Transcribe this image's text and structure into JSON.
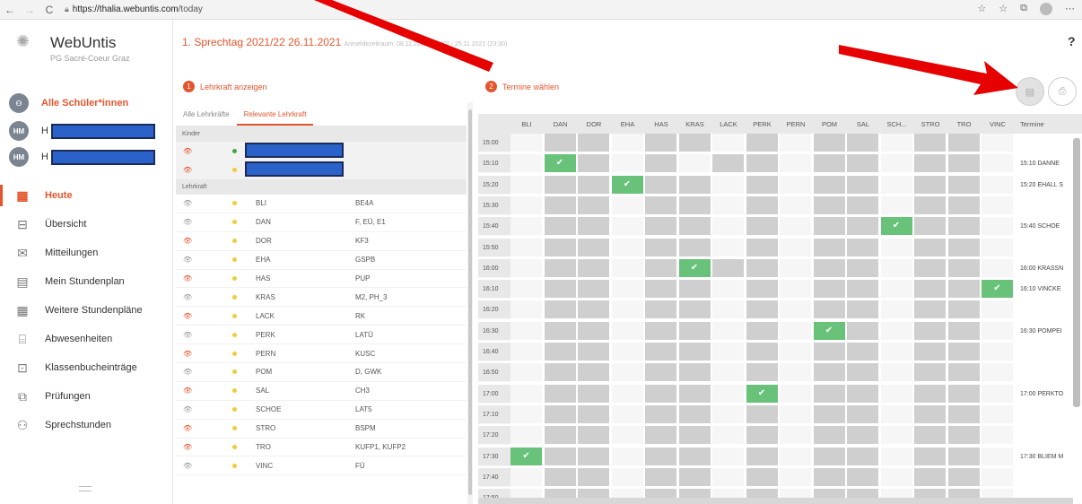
{
  "browser": {
    "back": "←",
    "forward": "→",
    "reload": "C",
    "url_host": "https://thalia.webuntis.com",
    "url_path": "/today"
  },
  "sidebar": {
    "brand": "WebUntis",
    "school": "PG Sacré-Coeur Graz",
    "all_students": "Alle Schüler*innen",
    "students": [
      {
        "initials": "HM",
        "name_prefix": "H"
      },
      {
        "initials": "HM",
        "name_prefix": "H"
      }
    ],
    "menu": [
      {
        "label": "Heute",
        "icon": "today-icon",
        "active": true
      },
      {
        "label": "Übersicht",
        "icon": "overview-icon"
      },
      {
        "label": "Mitteilungen",
        "icon": "mail-icon"
      },
      {
        "label": "Mein Stundenplan",
        "icon": "calendar-icon"
      },
      {
        "label": "Weitere Stundenpläne",
        "icon": "calendar-grid-icon"
      },
      {
        "label": "Abwesenheiten",
        "icon": "absence-icon"
      },
      {
        "label": "Klassenbucheinträge",
        "icon": "classbook-icon"
      },
      {
        "label": "Prüfungen",
        "icon": "exam-icon"
      },
      {
        "label": "Sprechstunden",
        "icon": "consultation-icon"
      }
    ]
  },
  "header": {
    "title": "1. Sprechtag 2021/22 26.11.2021",
    "registration": "Anmeldezeitraum: 08.11.2021 (00:00) - 25.11.2021 (23:30)",
    "help": "?"
  },
  "steps": {
    "step1": {
      "num": "1",
      "label": "Lehrkraft anzeigen"
    },
    "step2": {
      "num": "2",
      "label": "Termine wählen"
    }
  },
  "teacher_tabs": {
    "all": "Alle Lehrkräfte",
    "relevant": "Relevante Lehrkraft"
  },
  "groups": {
    "kinder": "Kinder",
    "lehrkraft": "Lehrkraft"
  },
  "teachers": [
    {
      "code": "BLI",
      "subjects": "BE4A",
      "eye": "grey"
    },
    {
      "code": "DAN",
      "subjects": "F, EÜ, E1",
      "eye": "grey"
    },
    {
      "code": "DOR",
      "subjects": "KF3",
      "eye": "red"
    },
    {
      "code": "EHA",
      "subjects": "GSPB",
      "eye": "grey"
    },
    {
      "code": "HAS",
      "subjects": "PUP",
      "eye": "red"
    },
    {
      "code": "KRAS",
      "subjects": "M2, PH_3",
      "eye": "grey"
    },
    {
      "code": "LACK",
      "subjects": "RK",
      "eye": "red"
    },
    {
      "code": "PERK",
      "subjects": "LATÜ",
      "eye": "grey"
    },
    {
      "code": "PERN",
      "subjects": "KUSC",
      "eye": "red"
    },
    {
      "code": "POM",
      "subjects": "D, GWK",
      "eye": "grey"
    },
    {
      "code": "SAL",
      "subjects": "CH3",
      "eye": "red"
    },
    {
      "code": "SCHOE",
      "subjects": "LAT5",
      "eye": "grey"
    },
    {
      "code": "STRO",
      "subjects": "BSPM",
      "eye": "red"
    },
    {
      "code": "TRO",
      "subjects": "KUFP1, KUFP2",
      "eye": "red"
    },
    {
      "code": "VINC",
      "subjects": "FÜ",
      "eye": "grey"
    }
  ],
  "grid": {
    "columns": [
      "BLI",
      "DAN",
      "DOR",
      "EHA",
      "HAS",
      "KRAS",
      "LACK",
      "PERK",
      "PERN",
      "POM",
      "SAL",
      "SCH...",
      "STRO",
      "TRO",
      "VINC"
    ],
    "termine_header": "Termine",
    "times": [
      "15:00",
      "15:10",
      "15:20",
      "15:30",
      "15:40",
      "15:50",
      "16:00",
      "16:10",
      "16:20",
      "16:30",
      "16:40",
      "16:50",
      "17:00",
      "17:10",
      "17:20",
      "17:30",
      "17:40",
      "17:50"
    ],
    "available": [
      [
        0,
        1,
        1,
        0,
        1,
        1,
        0,
        1,
        0,
        1,
        1,
        0,
        1,
        1,
        0
      ],
      [
        0,
        1,
        1,
        0,
        1,
        0,
        1,
        1,
        0,
        1,
        1,
        0,
        1,
        1,
        0
      ],
      [
        0,
        1,
        1,
        0,
        1,
        1,
        0,
        1,
        0,
        1,
        1,
        0,
        1,
        1,
        0
      ],
      [
        0,
        1,
        1,
        0,
        1,
        1,
        0,
        1,
        0,
        1,
        1,
        0,
        1,
        1,
        0
      ],
      [
        0,
        1,
        1,
        0,
        1,
        1,
        0,
        1,
        0,
        1,
        1,
        0,
        1,
        1,
        0
      ],
      [
        0,
        1,
        1,
        0,
        1,
        1,
        0,
        1,
        0,
        1,
        1,
        0,
        1,
        1,
        0
      ],
      [
        0,
        1,
        1,
        0,
        1,
        0,
        1,
        1,
        0,
        1,
        1,
        0,
        1,
        1,
        0
      ],
      [
        0,
        1,
        1,
        0,
        1,
        1,
        0,
        1,
        0,
        1,
        1,
        0,
        1,
        1,
        0
      ],
      [
        0,
        1,
        1,
        0,
        1,
        1,
        0,
        1,
        0,
        1,
        1,
        0,
        1,
        1,
        0
      ],
      [
        0,
        1,
        1,
        0,
        1,
        1,
        0,
        1,
        0,
        1,
        1,
        0,
        1,
        1,
        0
      ],
      [
        0,
        1,
        1,
        0,
        1,
        1,
        0,
        1,
        0,
        1,
        1,
        0,
        1,
        1,
        0
      ],
      [
        0,
        1,
        1,
        0,
        1,
        1,
        0,
        1,
        0,
        1,
        1,
        0,
        1,
        1,
        0
      ],
      [
        0,
        1,
        1,
        0,
        1,
        1,
        0,
        1,
        0,
        1,
        1,
        0,
        1,
        1,
        0
      ],
      [
        0,
        1,
        1,
        0,
        1,
        1,
        0,
        1,
        0,
        1,
        1,
        0,
        1,
        1,
        0
      ],
      [
        0,
        1,
        1,
        0,
        1,
        1,
        0,
        1,
        0,
        1,
        1,
        0,
        1,
        1,
        0
      ],
      [
        0,
        1,
        1,
        0,
        1,
        1,
        0,
        1,
        0,
        1,
        1,
        0,
        1,
        1,
        0
      ],
      [
        0,
        1,
        1,
        0,
        1,
        1,
        0,
        1,
        0,
        1,
        1,
        0,
        1,
        1,
        0
      ],
      [
        0,
        1,
        1,
        0,
        1,
        1,
        0,
        1,
        0,
        1,
        1,
        0,
        1,
        1,
        0
      ]
    ],
    "selected": [
      {
        "time": "15:10",
        "col": "DAN"
      },
      {
        "time": "15:20",
        "col": "EHA"
      },
      {
        "time": "15:40",
        "col": "SCH..."
      },
      {
        "time": "16:00",
        "col": "KRAS"
      },
      {
        "time": "16:10",
        "col": "VINC"
      },
      {
        "time": "16:30",
        "col": "POM"
      },
      {
        "time": "17:00",
        "col": "PERK"
      },
      {
        "time": "17:30",
        "col": "BLI"
      }
    ],
    "termine": [
      {
        "time": "15:10",
        "text": "15:10 DANNE"
      },
      {
        "time": "15:20",
        "text": "15:20 EHALL S"
      },
      {
        "time": "15:40",
        "text": "15:40 SCHOE"
      },
      {
        "time": "16:00",
        "text": "16:00 KRASSN"
      },
      {
        "time": "16:10",
        "text": "16:10 VINCKE"
      },
      {
        "time": "16:30",
        "text": "16:30 POMPEI"
      },
      {
        "time": "17:00",
        "text": "17:00 PERKTO"
      },
      {
        "time": "17:30",
        "text": "17:30 BLIEM M"
      }
    ]
  },
  "colors": {
    "accent": "#e4552d",
    "selected": "#69c27a",
    "arrow": "#e60000"
  }
}
